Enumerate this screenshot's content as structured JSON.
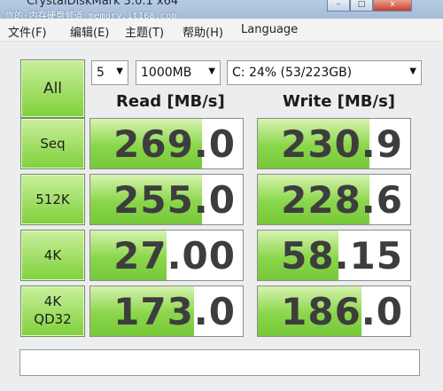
{
  "window": {
    "title": "CrystalDiskMark 3.0.1 x64",
    "watermark": "你的·内存硬盘频道 memory.it168.com",
    "buttons": {
      "minimize": "–",
      "maximize": "□",
      "close": "x"
    }
  },
  "menu": {
    "items": [
      "文件(F)",
      "编辑(E)",
      "主题(T)",
      "帮助(H)",
      "Language"
    ]
  },
  "controls": {
    "all_label": "All",
    "count_value": "5",
    "size_value": "1000MB",
    "drive_value": "C: 24% (53/223GB)"
  },
  "headers": {
    "read": "Read [MB/s]",
    "write": "Write [MB/s]"
  },
  "rows": [
    {
      "label": "Seq",
      "read": "269.0",
      "write": "230.9",
      "read_fill": 0.73,
      "write_fill": 0.73
    },
    {
      "label": "512K",
      "read": "255.0",
      "write": "228.6",
      "read_fill": 0.73,
      "write_fill": 0.73
    },
    {
      "label": "4K",
      "read": "27.00",
      "write": "58.15",
      "read_fill": 0.5,
      "write_fill": 0.53
    },
    {
      "label": "4K\nQD32",
      "read": "173.0",
      "write": "186.0",
      "read_fill": 0.68,
      "write_fill": 0.68
    }
  ],
  "status_text": "",
  "colors": {
    "accent_green": "#7fd13a",
    "title_blue": "#a3bcd9"
  }
}
